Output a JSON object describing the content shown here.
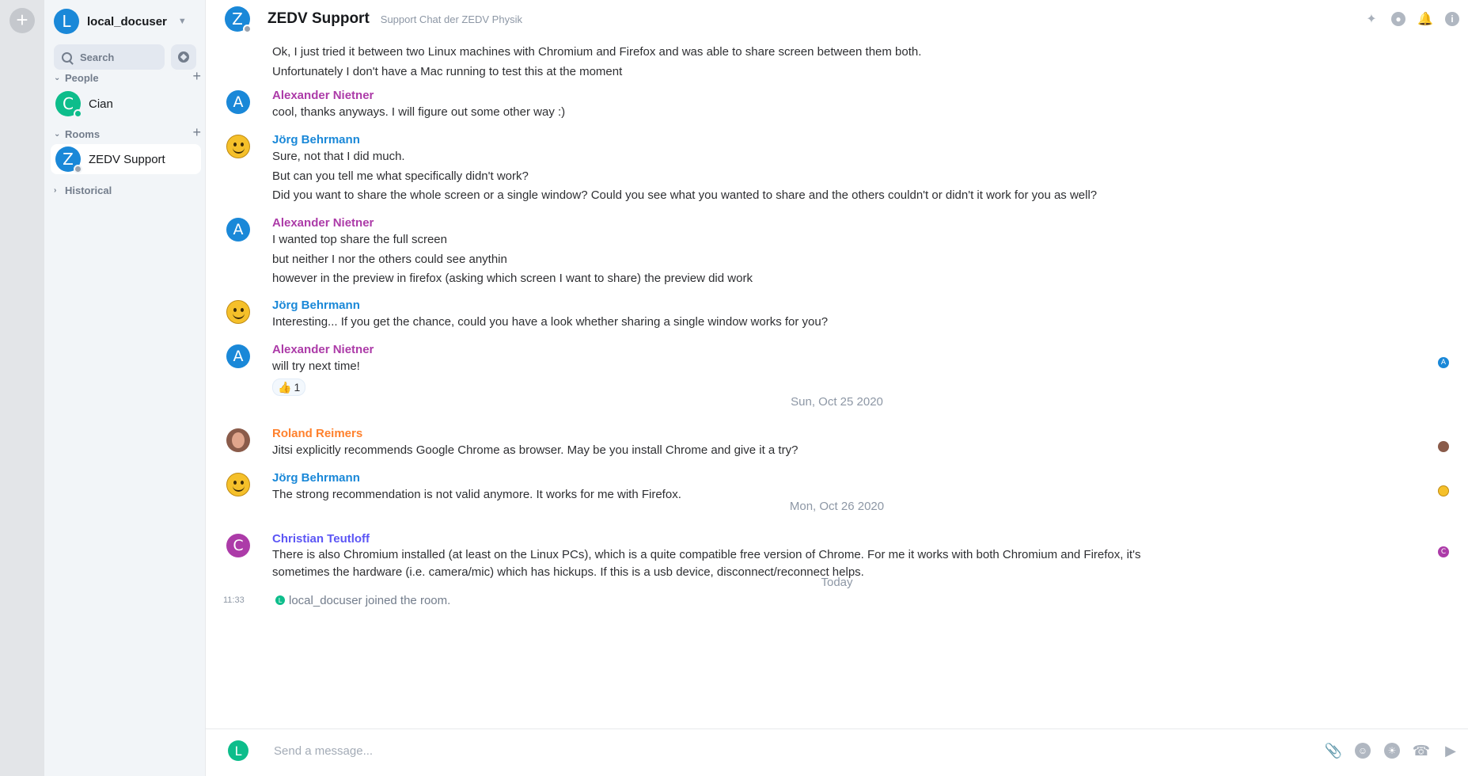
{
  "user": {
    "initial": "L",
    "name": "local_docuser"
  },
  "search": {
    "placeholder": "Search"
  },
  "sections": {
    "people": "People",
    "rooms": "Rooms",
    "historical": "Historical"
  },
  "people": [
    {
      "initial": "C",
      "name": "Cian"
    }
  ],
  "rooms": [
    {
      "initial": "Z",
      "name": "ZEDV Support"
    }
  ],
  "header": {
    "initial": "Z",
    "room_name": "ZEDV Support",
    "topic": "Support Chat der ZEDV Physik"
  },
  "timeline": {
    "continuation": [
      "Ok, I just tried it between two Linux machines with Chromium and Firefox and was able to share screen between them both.",
      "Unfortunately I don't have a Mac running to test this at the moment"
    ],
    "messages": [
      {
        "initial": "A",
        "sender": "Alexander Nietner",
        "lines": [
          "cool, thanks anyways. I will figure out some other way :)"
        ]
      },
      {
        "initial": "",
        "sender": "Jörg Behrmann",
        "lines": [
          "Sure, not that I did much.",
          "But can you tell me what specifically didn't work?",
          "Did you want to share the whole screen or a single window? Could you see what you wanted to share and the others couldn't or didn't it work for you as well?"
        ]
      },
      {
        "initial": "A",
        "sender": "Alexander Nietner",
        "lines": [
          "I wanted top share the full screen",
          "but neither I nor the others could see anythin",
          "however in the preview in firefox (asking which screen I want to share) the preview did work"
        ]
      },
      {
        "initial": "",
        "sender": "Jörg Behrmann",
        "lines": [
          "Interesting... If you get the chance, could you have a look whether sharing a single window works for you?"
        ]
      },
      {
        "initial": "A",
        "sender": "Alexander Nietner",
        "lines": [
          "will try next time!"
        ],
        "reaction": {
          "emoji": "👍",
          "count": "1"
        },
        "receipt": "A"
      },
      {
        "initial": "",
        "sender": "Roland Reimers",
        "lines": [
          "Jitsi explicitly recommends Google Chrome as browser. May be you install Chrome and give it a try?"
        ]
      },
      {
        "initial": "",
        "sender": "Jörg Behrmann",
        "lines": [
          "The strong recommendation is not valid anymore. It works for me with Firefox."
        ]
      },
      {
        "initial": "C",
        "sender": "Christian Teutloff",
        "lines": [
          "There is also Chromium installed (at least on the Linux PCs), which is a quite compatible free version of Chrome. For me it works with both Chromium and Firefox, it's sometimes the hardware (i.e. camera/mic) which has hickups. If this is a usb device, disconnect/reconnect helps."
        ],
        "receipt": "C"
      }
    ],
    "date_separators": [
      "Sun, Oct 25 2020",
      "Mon, Oct 26 2020",
      "Today"
    ],
    "event": {
      "time": "11:33",
      "initial": "L",
      "text": "local_docuser joined the room."
    }
  },
  "composer": {
    "initial": "L",
    "placeholder": "Send a message..."
  },
  "colors": {
    "accent": "#0dbd8b",
    "blue": "#1a88d8",
    "purple": "#ac3ba8",
    "orange": "#ff812d",
    "indigo": "#5c56f5"
  },
  "icons": {
    "header": [
      "threads-icon",
      "search-icon",
      "notifications-icon",
      "room-info-icon"
    ],
    "composer": [
      "attachment-icon",
      "emoji-icon",
      "sticker-icon",
      "voice-call-icon",
      "video-call-icon"
    ]
  }
}
